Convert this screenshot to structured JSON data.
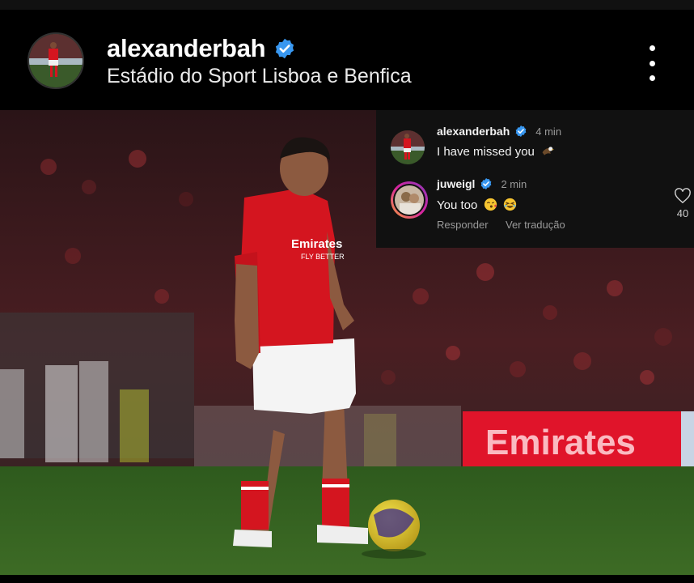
{
  "header": {
    "username": "alexanderbah",
    "location": "Estádio do Sport Lisboa e Benfica",
    "more_icon": "more-vertical-icon"
  },
  "photo": {
    "banner_text": "Emirates",
    "shirt_text": "Emirates",
    "shirt_sub": "FLY BETTER",
    "colors": {
      "kit_red": "#d4151f",
      "pitch_green": "#2f5a1e",
      "banner_red": "#e0142a"
    }
  },
  "comments": [
    {
      "author": "alexanderbah",
      "verified": true,
      "time": "4 min",
      "text": "I have missed you",
      "emoji": [
        "eagle"
      ]
    },
    {
      "author": "juweigl",
      "verified": true,
      "time": "2 min",
      "text": "You too",
      "emoji": [
        "kissing-face",
        "laughing-face"
      ],
      "reply_label": "Responder",
      "translate_label": "Ver tradução",
      "likes": "40"
    }
  ],
  "colors": {
    "accent_verified": "#3897f0",
    "background": "#000000",
    "panel": "#111111"
  }
}
